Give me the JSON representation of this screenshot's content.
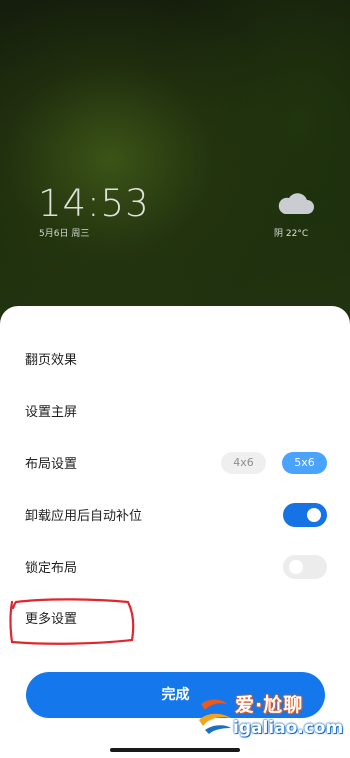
{
  "lockscreen": {
    "time": "14:53",
    "date": "5月6日 周三",
    "weather": "阴 22°C",
    "weather_icon": "cloud-icon"
  },
  "settings_sheet": {
    "items": [
      {
        "label": "翻页效果"
      },
      {
        "label": "设置主屏"
      },
      {
        "label": "布局设置",
        "options": [
          "4x6",
          "5x6"
        ],
        "selected": "5x6"
      },
      {
        "label": "卸载应用后自动补位",
        "toggle": true
      },
      {
        "label": "锁定布局",
        "toggle": false
      },
      {
        "label": "更多设置"
      }
    ],
    "done_label": "完成"
  },
  "watermark": {
    "cn": "爱·尬聊",
    "en": "igaliao.com"
  },
  "colors": {
    "accent": "#1478ec",
    "selected_option": "#4aa3ff",
    "annotation": "#e0262e"
  }
}
